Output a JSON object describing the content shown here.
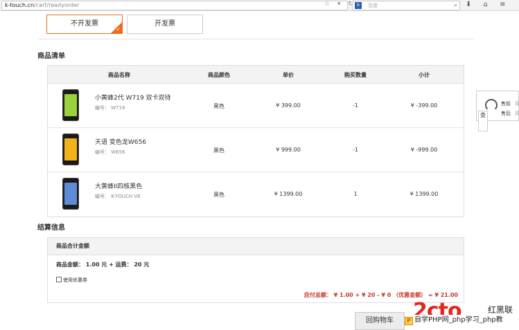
{
  "browser": {
    "url_host": "k-touch.cn",
    "url_path": "/cart/readyorder",
    "search_placeholder": "百度",
    "url_icons": "☆ ▾ ↻",
    "search_icon": "magnifier-icon",
    "toolbar_icons": "⬇ ⌂ ≡"
  },
  "invoice": {
    "no_invoice_label": "不开发票",
    "invoice_label": "开发票",
    "check_mark": "✓"
  },
  "goods": {
    "section_title": "商品清单",
    "headers": [
      "商品名称",
      "商品颜色",
      "单价",
      "购买数量",
      "小计"
    ],
    "items": [
      {
        "name": "小黄蜂2代 W719 双卡双待",
        "code": "编号：  W719",
        "color": "黑色",
        "price": "¥  399.00",
        "qty": "-1",
        "subtotal": "¥  -399.00"
      },
      {
        "name": "天语 变色龙W656",
        "code": "编号：  W656",
        "color": "黑色",
        "price": "¥  999.00",
        "qty": "-1",
        "subtotal": "¥  -999.00"
      },
      {
        "name": "大黄蜂II四核黑色",
        "code": "编号：  K-TOUCH V8",
        "color": "黑色",
        "price": "¥  1399.00",
        "qty": "1",
        "subtotal": "¥  1399.00"
      }
    ],
    "screen_colors": [
      "#9bd13b",
      "#f2b21b",
      "#5f8bd6"
    ]
  },
  "settlement": {
    "section_title": "结算信息",
    "subheader": "商品合计金额",
    "amount_line": "商品金额：  1.00 元  +  运费：  20 元",
    "coupon_label": "使用优惠券",
    "total_line": "应付总额：  ¥ 1.00  +  ¥ 20  -  ¥ 0  （优惠金额）  =  ¥ 21.00"
  },
  "back_button": "回购物车",
  "watermark": {
    "logo_text": "2cto",
    "site_name": "红黑联盟",
    "bar_icon": "P",
    "bar_text": "自学PHP网_php学习_php教"
  },
  "side_widget": {
    "line1": "售前",
    "line2": "售后",
    "gray1": "周",
    "gray2": "周",
    "tab_text": "查"
  }
}
